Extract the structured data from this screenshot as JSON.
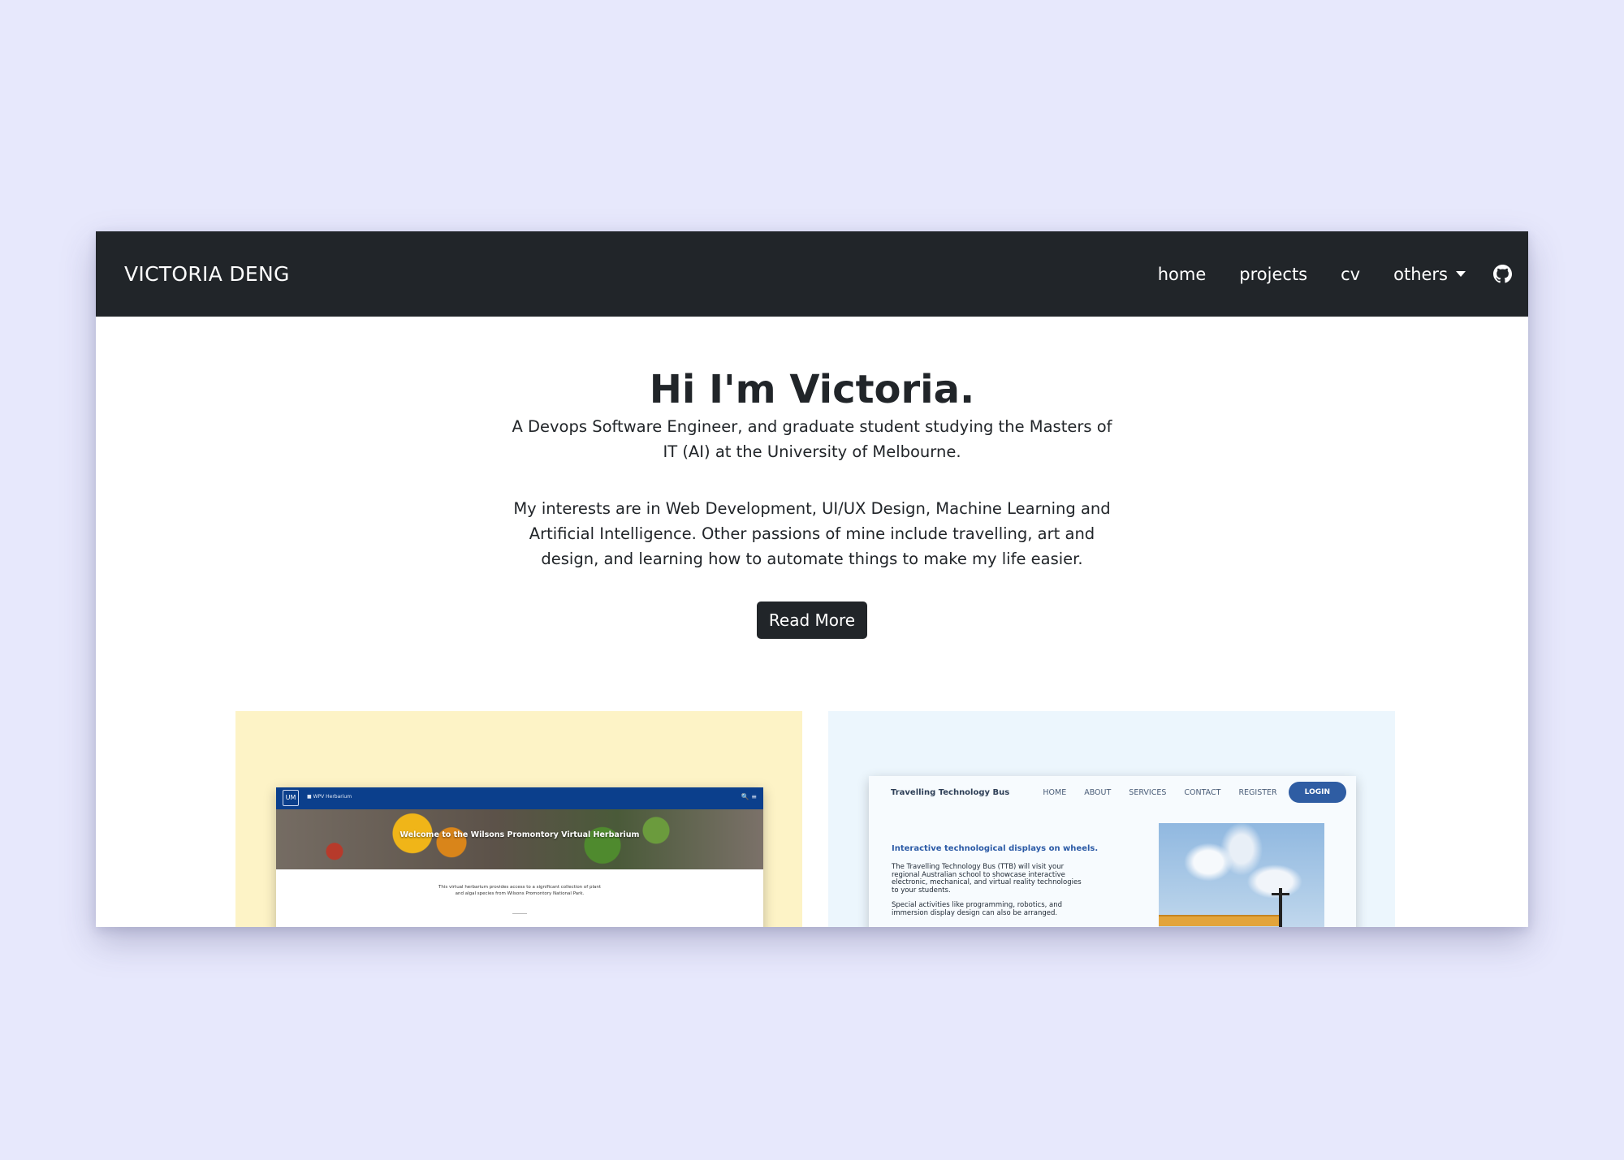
{
  "navbar": {
    "brand": "VICTORIA DENG",
    "links": [
      "home",
      "projects",
      "cv",
      "others"
    ]
  },
  "hero": {
    "title": "Hi I'm Victoria.",
    "paragraph1": "A Devops Software Engineer, and graduate student studying the Masters of IT (AI) at the University of Melbourne.",
    "paragraph2": "My interests are in Web Development, UI/UX Design, Machine Learning and Artificial Intelligence. Other passions of mine include travelling, art and design, and learning how to automate things to make my life easier.",
    "button_label": "Read More"
  },
  "projects": [
    {
      "bg_color": "#fdf3c6",
      "nav_text": "■ WPV Herbarium",
      "icons_text": "🔍 ≡",
      "logo_text": "UM",
      "hero_title": "Welcome to the Wilsons Promontory Virtual Herbarium",
      "body_text": "This virtual herbarium provides access to a significant collection of plant and algal species from Wilsons Promontory National Park."
    },
    {
      "bg_color": "#ecf6fd",
      "brand": "Travelling Technology Bus",
      "nav": [
        "HOME",
        "ABOUT",
        "SERVICES",
        "CONTACT",
        "REGISTER"
      ],
      "login": "LOGIN",
      "heading": "Interactive technological displays on wheels.",
      "para1": "The Travelling Technology Bus (TTB) will visit your regional Australian school to showcase interactive electronic, mechanical, and virtual reality technologies to your students.",
      "para2": "Special activities like programming, robotics, and immersion display design can also be arranged."
    }
  ],
  "icons": {
    "others_dropdown": "chevron-down-icon",
    "github": "github-icon"
  },
  "colors": {
    "page_bg": "#e7e8fc",
    "navbar_bg": "#212529",
    "button_bg": "#212529"
  }
}
